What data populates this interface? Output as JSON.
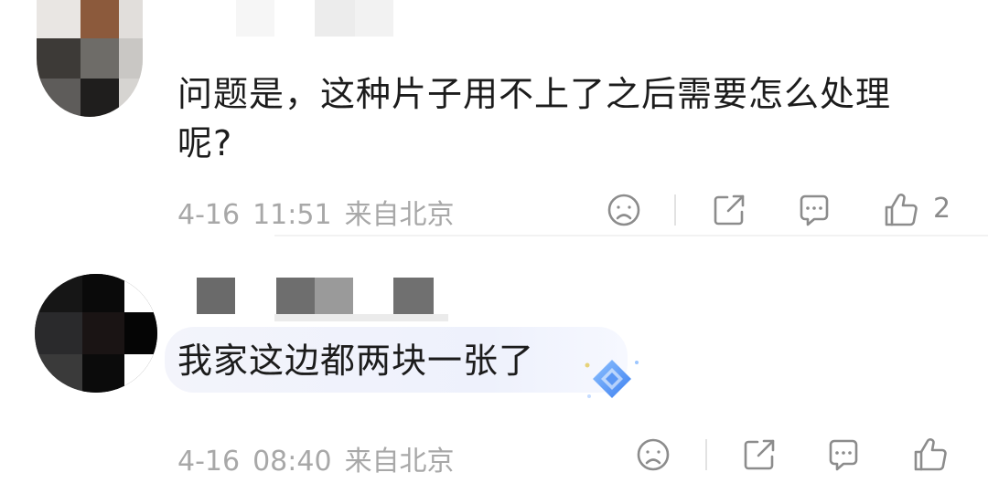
{
  "comments": [
    {
      "text_line1": "问题是，这种片子用不上了之后需要怎么处理",
      "text_line2": "呢?",
      "date": "4-16",
      "time": "11:51",
      "location": "来自北京",
      "likes": "2"
    },
    {
      "text_line1": "我家这边都两块一张了",
      "date": "4-16",
      "time": "08:40",
      "location": "来自北京",
      "likes": ""
    }
  ],
  "icons": {
    "dislike": "sad-face-icon",
    "share": "share-icon",
    "reply": "comment-bubble-icon",
    "like": "thumbs-up-icon",
    "sticker": "diamond-badge-icon"
  },
  "colors": {
    "text": "#1c1c1c",
    "meta": "#a8a8a8",
    "icon": "#8c8c8c",
    "badge": "#4a8cf2"
  }
}
